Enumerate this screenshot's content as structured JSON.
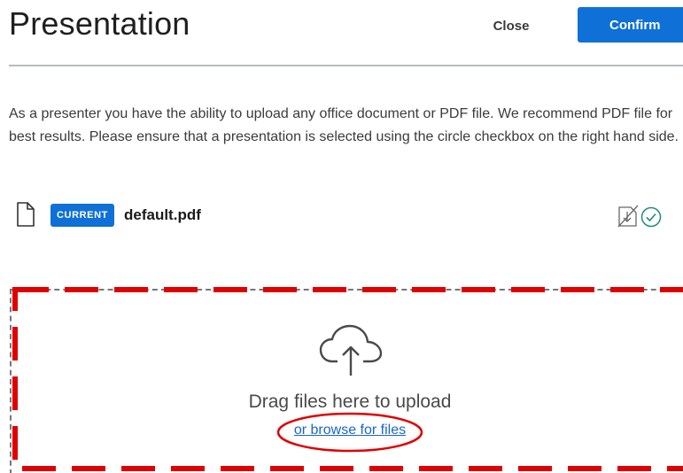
{
  "header": {
    "title": "Presentation",
    "close_label": "Close",
    "confirm_label": "Confirm"
  },
  "description": "As a presenter you have the ability to upload any office document or PDF file. We recommend PDF file for best results. Please ensure that a presentation is selected using the circle checkbox on the right hand side.",
  "files": [
    {
      "badge": "CURRENT",
      "name": "default.pdf",
      "icon": "document-icon",
      "actions": [
        "download-disabled-icon",
        "check-circle-icon"
      ]
    }
  ],
  "dropzone": {
    "icon": "cloud-upload-icon",
    "drag_text": "Drag files here to upload",
    "browse_text": "or browse for files"
  },
  "colors": {
    "accent": "#0f70d7",
    "check_green": "#1d8c7a",
    "annotation_red": "#e00000"
  }
}
